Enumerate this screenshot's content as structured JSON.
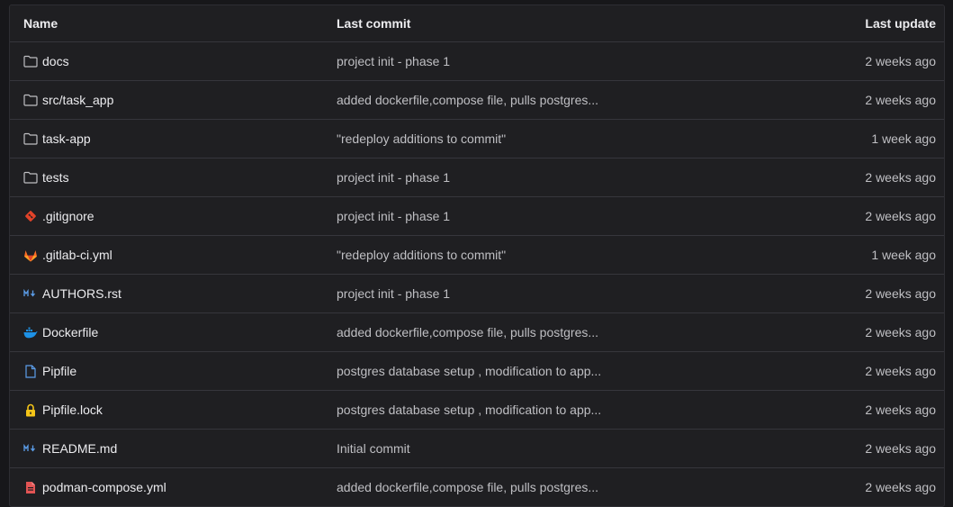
{
  "header": {
    "name": "Name",
    "last_commit": "Last commit",
    "last_update": "Last update"
  },
  "rows": [
    {
      "name": "docs",
      "icon": "folder-icon",
      "commit": "project init - phase 1",
      "date": "2 weeks ago"
    },
    {
      "name": "src/task_app",
      "icon": "folder-icon",
      "commit": "added dockerfile,compose file, pulls postgres...",
      "date": "2 weeks ago"
    },
    {
      "name": "task-app",
      "icon": "folder-icon",
      "commit": "\"redeploy additions to commit\"",
      "date": "1 week ago"
    },
    {
      "name": "tests",
      "icon": "folder-icon",
      "commit": "project init - phase 1",
      "date": "2 weeks ago"
    },
    {
      "name": ".gitignore",
      "icon": "git-icon",
      "commit": "project init - phase 1",
      "date": "2 weeks ago"
    },
    {
      "name": ".gitlab-ci.yml",
      "icon": "gitlab-icon",
      "commit": "\"redeploy additions to commit\"",
      "date": "1 week ago"
    },
    {
      "name": "AUTHORS.rst",
      "icon": "markdown-icon",
      "commit": "project init - phase 1",
      "date": "2 weeks ago"
    },
    {
      "name": "Dockerfile",
      "icon": "docker-icon",
      "commit": "added dockerfile,compose file, pulls postgres...",
      "date": "2 weeks ago"
    },
    {
      "name": "Pipfile",
      "icon": "file-icon",
      "commit": "postgres database setup , modification to app...",
      "date": "2 weeks ago"
    },
    {
      "name": "Pipfile.lock",
      "icon": "lock-icon",
      "commit": "postgres database setup , modification to app...",
      "date": "2 weeks ago"
    },
    {
      "name": "README.md",
      "icon": "markdown-icon",
      "commit": "Initial commit",
      "date": "2 weeks ago"
    },
    {
      "name": "podman-compose.yml",
      "icon": "yaml-file-icon",
      "commit": "added dockerfile,compose file, pulls postgres...",
      "date": "2 weeks ago"
    }
  ],
  "colors": {
    "background": "#1f1f22",
    "text": "#ececef",
    "muted_text": "#bfbfc3",
    "divider": "#36363c",
    "git": "#e24329",
    "gitlab": "#fc6d26",
    "markdown": "#5c9eea",
    "docker": "#1d91e6",
    "file": "#5c9eea",
    "lock": "#f5c518",
    "yaml": "#e25454"
  }
}
